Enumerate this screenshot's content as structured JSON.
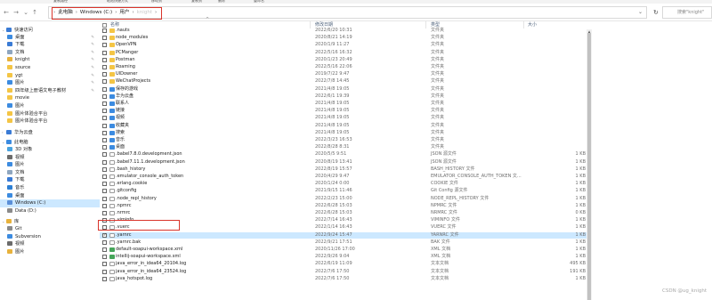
{
  "menubar": {
    "items": [
      "复制路径",
      "粘贴快捷方式",
      "移动到",
      "复制到",
      "删除",
      "重命名"
    ]
  },
  "address": {
    "back": "←",
    "forward": "→",
    "recent": "⌄",
    "up": "↑",
    "crumbs": [
      "此电脑",
      "Windows (C:)",
      "用户",
      "knight"
    ],
    "search_placeholder": "搜索\"knight\""
  },
  "columns": {
    "name": "名称",
    "date": "修改日期",
    "type": "类型",
    "size": "大小"
  },
  "nav": [
    {
      "label": "快速访问",
      "icon": "star-icon",
      "exp": "⌄",
      "color": "#3a7bd5",
      "indent": 0
    },
    {
      "label": "桌面",
      "icon": "desktop-icon",
      "pin": true,
      "color": "#3c8be0",
      "indent": 1
    },
    {
      "label": "下载",
      "icon": "download-icon",
      "pin": true,
      "color": "#3a7bd5",
      "indent": 1
    },
    {
      "label": "文档",
      "icon": "document-icon",
      "pin": true,
      "color": "#8fa6bf",
      "indent": 1
    },
    {
      "label": "knight",
      "icon": "user-folder-icon",
      "pin": true,
      "color": "#e8b23c",
      "indent": 1
    },
    {
      "label": "source",
      "icon": "folder-icon",
      "pin": true,
      "color": "#f4c545",
      "indent": 1
    },
    {
      "label": "ygt",
      "icon": "folder-icon",
      "pin": true,
      "color": "#f4c545",
      "indent": 1
    },
    {
      "label": "图片",
      "icon": "pictures-icon",
      "pin": true,
      "color": "#3c8be0",
      "indent": 1
    },
    {
      "label": "四年级上册语文电子教材",
      "icon": "folder-icon",
      "pin": true,
      "color": "#f4c545",
      "indent": 1
    },
    {
      "label": "movie",
      "icon": "folder-icon",
      "color": "#f4c545",
      "indent": 1
    },
    {
      "label": "图片",
      "icon": "pictures-icon",
      "color": "#3c8be0",
      "indent": 1
    },
    {
      "label": "图片体验合平台",
      "icon": "folder-icon",
      "color": "#f4c545",
      "indent": 1
    },
    {
      "label": "图片体验合平台",
      "icon": "folder-icon",
      "color": "#f4c545",
      "indent": 1
    },
    {
      "label": "",
      "spacer": true
    },
    {
      "label": "华为云盘",
      "icon": "cloud-icon",
      "exp": "›",
      "color": "#3a7bd5",
      "indent": 0
    },
    {
      "label": "",
      "spacer": true
    },
    {
      "label": "此电脑",
      "icon": "computer-icon",
      "exp": "⌄",
      "color": "#3c8be0",
      "indent": 0
    },
    {
      "label": "3D 对象",
      "icon": "3d-objects-icon",
      "color": "#4aa3df",
      "indent": 1
    },
    {
      "label": "视频",
      "icon": "video-icon",
      "color": "#6b6b6b",
      "indent": 1
    },
    {
      "label": "图片",
      "icon": "pictures-icon",
      "color": "#3c8be0",
      "indent": 1
    },
    {
      "label": "文档",
      "icon": "document-icon",
      "color": "#8fa6bf",
      "indent": 1
    },
    {
      "label": "下载",
      "icon": "download-icon",
      "color": "#3a7bd5",
      "indent": 1
    },
    {
      "label": "音乐",
      "icon": "music-icon",
      "color": "#2d7fd4",
      "indent": 1
    },
    {
      "label": "桌面",
      "icon": "desktop-icon",
      "color": "#3c8be0",
      "indent": 1
    },
    {
      "label": "Windows (C:)",
      "icon": "drive-icon",
      "color": "#5a8fd8",
      "indent": 1,
      "selected": true
    },
    {
      "label": "Data (D:)",
      "icon": "drive-icon",
      "color": "#8a8a8a",
      "indent": 1
    },
    {
      "label": "",
      "spacer": true
    },
    {
      "label": "库",
      "icon": "library-icon",
      "exp": "⌄",
      "color": "#e8b23c",
      "indent": 0
    },
    {
      "label": "Git",
      "icon": "git-icon",
      "color": "#8a8a8a",
      "indent": 1
    },
    {
      "label": "Subversion",
      "icon": "svn-icon",
      "color": "#3c8be0",
      "indent": 1
    },
    {
      "label": "视频",
      "icon": "video-icon",
      "color": "#6b6b6b",
      "indent": 1
    },
    {
      "label": "图片",
      "icon": "pictures-icon",
      "color": "#e8b23c",
      "indent": 1
    }
  ],
  "files": [
    {
      "name": ".nauts",
      "date": "2022/6/20 10:31",
      "type": "文件夹",
      "size": "",
      "kind": "folder"
    },
    {
      "name": "node_modules",
      "date": "2020/8/21 14:19",
      "type": "文件夹",
      "size": "",
      "kind": "folder"
    },
    {
      "name": "OpenVPN",
      "date": "2020/1/9 11:27",
      "type": "文件夹",
      "size": "",
      "kind": "folder"
    },
    {
      "name": "PCManger",
      "date": "2022/5/16 16:32",
      "type": "文件夹",
      "size": "",
      "kind": "folder"
    },
    {
      "name": "Postman",
      "date": "2020/1/23 20:49",
      "type": "文件夹",
      "size": "",
      "kind": "folder"
    },
    {
      "name": "Roaming",
      "date": "2022/5/16 22:06",
      "type": "文件夹",
      "size": "",
      "kind": "folder"
    },
    {
      "name": "UIDowner",
      "date": "2019/7/22 9:47",
      "type": "文件夹",
      "size": "",
      "kind": "folder"
    },
    {
      "name": "WeChatProjects",
      "date": "2022/7/8 14:45",
      "type": "文件夹",
      "size": "",
      "kind": "folder"
    },
    {
      "name": "保存的游戏",
      "date": "2021/4/8 19:05",
      "type": "文件夹",
      "size": "",
      "kind": "special"
    },
    {
      "name": "华为云盘",
      "date": "2022/6/1 19:39",
      "type": "文件夹",
      "size": "",
      "kind": "cloud"
    },
    {
      "name": "联系人",
      "date": "2021/4/8 19:05",
      "type": "文件夹",
      "size": "",
      "kind": "special"
    },
    {
      "name": "链接",
      "date": "2021/4/8 19:05",
      "type": "文件夹",
      "size": "",
      "kind": "special"
    },
    {
      "name": "视频",
      "date": "2021/4/8 19:05",
      "type": "文件夹",
      "size": "",
      "kind": "special"
    },
    {
      "name": "收藏夹",
      "date": "2021/4/8 19:05",
      "type": "文件夹",
      "size": "",
      "kind": "special"
    },
    {
      "name": "搜索",
      "date": "2021/4/8 19:05",
      "type": "文件夹",
      "size": "",
      "kind": "special"
    },
    {
      "name": "音乐",
      "date": "2022/3/23 16:53",
      "type": "文件夹",
      "size": "",
      "kind": "special"
    },
    {
      "name": "桌面",
      "date": "2022/8/28 8:31",
      "type": "文件夹",
      "size": "",
      "kind": "special"
    },
    {
      "name": ".babel7.8.0.development.json",
      "date": "2020/5/5 9:51",
      "type": "JSON 源文件",
      "size": "1 KB",
      "kind": "file"
    },
    {
      "name": ".babel7.11.1.development.json",
      "date": "2020/8/19 13:41",
      "type": "JSON 源文件",
      "size": "1 KB",
      "kind": "file"
    },
    {
      "name": ".bash_history",
      "date": "2022/8/19 15:57",
      "type": "BASH_HISTORY 文件",
      "size": "1 KB",
      "kind": "file"
    },
    {
      "name": ".emulator_console_auth_token",
      "date": "2020/4/29 9:47",
      "type": "EMULATOR_CONSOLE_AUTH_TOKEN 文...",
      "size": "1 KB",
      "kind": "file"
    },
    {
      "name": ".erlang.cookie",
      "date": "2020/1/24 0:00",
      "type": "COOKIE 文件",
      "size": "1 KB",
      "kind": "file"
    },
    {
      "name": ".gitconfig",
      "date": "2021/9/15 11:46",
      "type": "Git Config 源文件",
      "size": "1 KB",
      "kind": "file"
    },
    {
      "name": ".node_repl_history",
      "date": "2022/2/23 15:00",
      "type": "NODE_REPL_HISTORY 文件",
      "size": "1 KB",
      "kind": "file"
    },
    {
      "name": ".npmrc",
      "date": "2022/6/28 15:03",
      "type": "NPMRC 文件",
      "size": "1 KB",
      "kind": "file"
    },
    {
      "name": ".nrmrc",
      "date": "2022/6/28 15:03",
      "type": "NRMRC 文件",
      "size": "0 KB",
      "kind": "file"
    },
    {
      "name": ".viminfo",
      "date": "2022/7/14 16:43",
      "type": "VIMINFO 文件",
      "size": "1 KB",
      "kind": "file"
    },
    {
      "name": ".vuerc",
      "date": "2022/1/14 16:43",
      "type": "VUERC 文件",
      "size": "1 KB",
      "kind": "file"
    },
    {
      "name": ".yarnrc",
      "date": "2022/9/24 15:47",
      "type": "YARNRC 文件",
      "size": "1 KB",
      "kind": "file",
      "selected": true
    },
    {
      "name": ".yarnrc.bak",
      "date": "2022/9/21 17:51",
      "type": "BAK 文件",
      "size": "1 KB",
      "kind": "file"
    },
    {
      "name": "default-soapui-workspace.xml",
      "date": "2020/11/26 17:00",
      "type": "XML 文档",
      "size": "1 KB",
      "kind": "xml"
    },
    {
      "name": "intellij-soapui-workspace.xml",
      "date": "2022/9/26 9:04",
      "type": "XML 文档",
      "size": "1 KB",
      "kind": "xml"
    },
    {
      "name": "java_error_in_idea64_20104.log",
      "date": "2022/6/19 11:09",
      "type": "文本文档",
      "size": "495 KB",
      "kind": "file"
    },
    {
      "name": "java_error_in_idea64_23524.log",
      "date": "2022/7/6 17:50",
      "type": "文本文档",
      "size": "191 KB",
      "kind": "file"
    },
    {
      "name": "java_hotspot.log",
      "date": "2022/7/6 17:50",
      "type": "文本文档",
      "size": "1 KB",
      "kind": "file"
    }
  ],
  "watermark": "CSDN @ug_knight"
}
